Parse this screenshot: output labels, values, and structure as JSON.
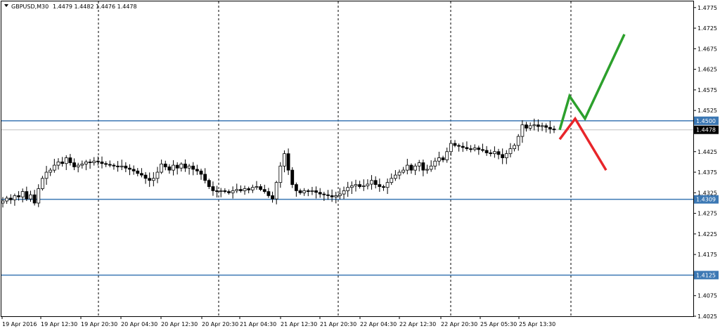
{
  "header": {
    "symbol": "GBPUSD,M30",
    "ohlc": "1.4479 1.4482 1.4476 1.4478"
  },
  "chart_data": {
    "type": "candlestick",
    "symbol": "GBPUSD",
    "timeframe": "M30",
    "y_ticks": [
      "1.4775",
      "1.4725",
      "1.4675",
      "1.4625",
      "1.4575",
      "1.4525",
      "1.4475",
      "1.4425",
      "1.4375",
      "1.4325",
      "1.4275",
      "1.4225",
      "1.4175",
      "1.4125",
      "1.4075",
      "1.4025"
    ],
    "x_ticks": [
      "19 Apr 2016",
      "19 Apr 12:30",
      "19 Apr 20:30",
      "20 Apr 04:30",
      "20 Apr 12:30",
      "20 Apr 20:30",
      "21 Apr 04:30",
      "21 Apr 12:30",
      "21 Apr 20:30",
      "22 Apr 04:30",
      "22 Apr 12:30",
      "22 Apr 20:30",
      "25 Apr 05:30",
      "25 Apr 13:30"
    ],
    "ylim": [
      1.4025,
      1.479
    ],
    "grid": "vertical-dashed",
    "horizontal_lines": [
      {
        "price": 1.45,
        "label": "1.4500",
        "color": "#3c78b4"
      },
      {
        "price": 1.4309,
        "label": "1.4309",
        "color": "#3c78b4"
      },
      {
        "price": 1.4125,
        "label": "1.4125",
        "color": "#3c78b4"
      }
    ],
    "current_price": {
      "price": 1.4478,
      "label": "1.4478"
    },
    "price_path": [
      1.4305,
      1.4312,
      1.4308,
      1.4318,
      1.4315,
      1.4328,
      1.431,
      1.432,
      1.43,
      1.4335,
      1.436,
      1.4375,
      1.438,
      1.4392,
      1.44,
      1.4396,
      1.441,
      1.4398,
      1.4388,
      1.4392,
      1.4395,
      1.44,
      1.4398,
      1.4402,
      1.44,
      1.4396,
      1.4394,
      1.4392,
      1.439,
      1.4388,
      1.439,
      1.4385,
      1.4382,
      1.4378,
      1.4372,
      1.4368,
      1.436,
      1.4355,
      1.436,
      1.4375,
      1.4395,
      1.4388,
      1.438,
      1.4392,
      1.4385,
      1.4395,
      1.4385,
      1.439,
      1.4382,
      1.4378,
      1.437,
      1.4355,
      1.434,
      1.433,
      1.4328,
      1.433,
      1.4328,
      1.4325,
      1.433,
      1.4333,
      1.433,
      1.4335,
      1.4332,
      1.4338,
      1.434,
      1.4333,
      1.4328,
      1.4318,
      1.431,
      1.435,
      1.439,
      1.442,
      1.438,
      1.4345,
      1.433,
      1.4325,
      1.433,
      1.4328,
      1.433,
      1.4326,
      1.4322,
      1.432,
      1.4318,
      1.4315,
      1.4318,
      1.4322,
      1.433,
      1.4338,
      1.4342,
      1.4345,
      1.434,
      1.4342,
      1.4346,
      1.4355,
      1.4345,
      1.434,
      1.4338,
      1.435,
      1.436,
      1.4368,
      1.4375,
      1.438,
      1.4392,
      1.438,
      1.439,
      1.4398,
      1.438,
      1.4382,
      1.439,
      1.4402,
      1.441,
      1.4405,
      1.4425,
      1.4445,
      1.444,
      1.4438,
      1.4435,
      1.4432,
      1.443,
      1.4434,
      1.443,
      1.4428,
      1.4422,
      1.442,
      1.4425,
      1.4418,
      1.441,
      1.442,
      1.4432,
      1.444,
      1.4462,
      1.449,
      1.4482,
      1.4488,
      1.449,
      1.4486,
      1.4488,
      1.4484,
      1.448,
      1.4478
    ],
    "projection": {
      "bullish": {
        "color": "#2ca02c",
        "points": [
          1.4478,
          1.456,
          1.4505,
          1.471
        ]
      },
      "bearish": {
        "color": "#e8252a",
        "points": [
          1.4455,
          1.4505,
          1.438
        ]
      }
    }
  }
}
